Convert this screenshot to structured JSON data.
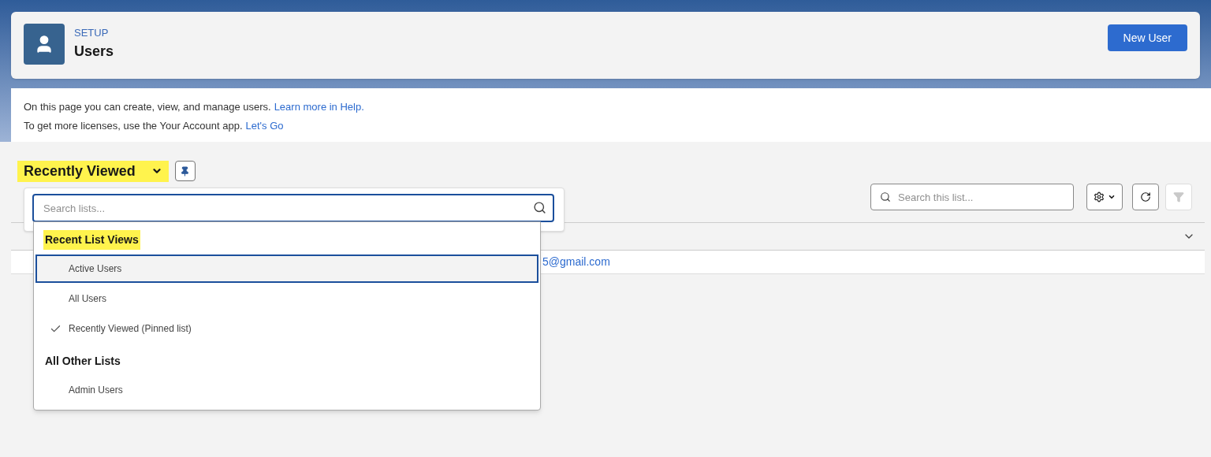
{
  "header": {
    "eyebrow": "SETUP",
    "title": "Users",
    "button": "New User"
  },
  "info": {
    "line_1": "On this page you can create, view, and manage users.",
    "link_1": "Learn more in Help.",
    "line_2": "To get more licenses, use the Your Account app.",
    "link_2": "Let's Go"
  },
  "list_view": {
    "title": "Recently Viewed",
    "highlighted": true,
    "search": {
      "placeholder": "Search this list..."
    },
    "filter_disabled": true
  },
  "table": {
    "rows": [
      {
        "cell": "5@gmail.com"
      }
    ]
  },
  "dropdown": {
    "search": {
      "placeholder": "Search lists..."
    },
    "groups": [
      {
        "heading": "Recent List Views",
        "highlighted": true,
        "items": [
          {
            "label": "Active Users",
            "focused": true,
            "selected": false
          },
          {
            "label": "All Users",
            "focused": false,
            "selected": false
          },
          {
            "label": "Recently Viewed (Pinned list)",
            "focused": false,
            "selected": true
          }
        ]
      },
      {
        "heading": "All Other Lists",
        "highlighted": false,
        "items": [
          {
            "label": "Admin Users",
            "focused": false,
            "selected": false
          }
        ]
      }
    ]
  }
}
